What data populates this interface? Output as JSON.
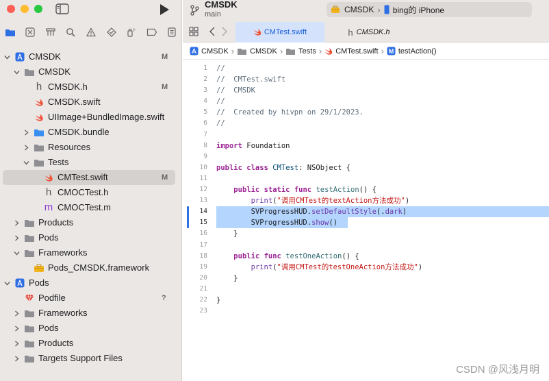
{
  "window": {
    "project_title": "CMSDK",
    "branch": "main",
    "scheme": {
      "target": "CMSDK",
      "device": "bing的 iPhone"
    }
  },
  "tabs": [
    {
      "label": "CMTest.swift",
      "active": true,
      "icon": "swift-file-icon"
    },
    {
      "label": "CMSDK.h",
      "active": false,
      "icon": "header-file-icon"
    }
  ],
  "breadcrumb": [
    "CMSDK",
    "CMSDK",
    "Tests",
    "CMTest.swift",
    "testAction()"
  ],
  "navigator": [
    {
      "label": "CMSDK",
      "level": 0,
      "icon": "app-project-icon",
      "chevron": "down",
      "badge": "M"
    },
    {
      "label": "CMSDK",
      "level": 1,
      "icon": "folder-icon",
      "chevron": "down",
      "badge": ""
    },
    {
      "label": "CMSDK.h",
      "level": 2,
      "icon": "header-file-icon",
      "chevron": "",
      "badge": "M"
    },
    {
      "label": "CMSDK.swift",
      "level": 2,
      "icon": "swift-file-icon",
      "chevron": "",
      "badge": ""
    },
    {
      "label": "UIImage+BundledImage.swift",
      "level": 2,
      "icon": "swift-file-icon",
      "chevron": "",
      "badge": ""
    },
    {
      "label": "CMSDK.bundle",
      "level": 2,
      "icon": "bundle-folder-icon",
      "chevron": "right",
      "badge": ""
    },
    {
      "label": "Resources",
      "level": 2,
      "icon": "folder-icon",
      "chevron": "right",
      "badge": ""
    },
    {
      "label": "Tests",
      "level": 2,
      "icon": "folder-icon",
      "chevron": "down",
      "badge": ""
    },
    {
      "label": "CMTest.swift",
      "level": 3,
      "icon": "swift-file-icon",
      "chevron": "",
      "badge": "M",
      "selected": true
    },
    {
      "label": "CMOCTest.h",
      "level": 3,
      "icon": "header-file-icon",
      "chevron": "",
      "badge": ""
    },
    {
      "label": "CMOCTest.m",
      "level": 3,
      "icon": "objc-file-icon",
      "chevron": "",
      "badge": ""
    },
    {
      "label": "Products",
      "level": 1,
      "icon": "folder-icon",
      "chevron": "right",
      "badge": ""
    },
    {
      "label": "Pods",
      "level": 1,
      "icon": "folder-icon",
      "chevron": "right",
      "badge": ""
    },
    {
      "label": "Frameworks",
      "level": 1,
      "icon": "folder-icon",
      "chevron": "down",
      "badge": ""
    },
    {
      "label": "Pods_CMSDK.framework",
      "level": 2,
      "icon": "framework-icon",
      "chevron": "",
      "badge": ""
    },
    {
      "label": "Pods",
      "level": 0,
      "icon": "app-project-icon",
      "chevron": "down",
      "badge": ""
    },
    {
      "label": "Podfile",
      "level": 1,
      "icon": "ruby-file-icon",
      "chevron": "",
      "badge": "?"
    },
    {
      "label": "Frameworks",
      "level": 1,
      "icon": "folder-icon",
      "chevron": "right",
      "badge": ""
    },
    {
      "label": "Pods",
      "level": 1,
      "icon": "folder-icon",
      "chevron": "right",
      "badge": ""
    },
    {
      "label": "Products",
      "level": 1,
      "icon": "folder-icon",
      "chevron": "right",
      "badge": ""
    },
    {
      "label": "Targets Support Files",
      "level": 1,
      "icon": "folder-icon",
      "chevron": "right",
      "badge": ""
    }
  ],
  "code": [
    {
      "n": "1",
      "hl": false,
      "parts": [
        [
          "cm",
          "//"
        ]
      ]
    },
    {
      "n": "2",
      "hl": false,
      "parts": [
        [
          "cm",
          "//  CMTest.swift"
        ]
      ]
    },
    {
      "n": "3",
      "hl": false,
      "parts": [
        [
          "cm",
          "//  CMSDK"
        ]
      ]
    },
    {
      "n": "4",
      "hl": false,
      "parts": [
        [
          "cm",
          "//"
        ]
      ]
    },
    {
      "n": "5",
      "hl": false,
      "parts": [
        [
          "cm",
          "//  Created by hivpn on 29/1/2023."
        ]
      ]
    },
    {
      "n": "6",
      "hl": false,
      "parts": [
        [
          "cm",
          "//"
        ]
      ]
    },
    {
      "n": "7",
      "hl": false,
      "parts": []
    },
    {
      "n": "8",
      "hl": false,
      "parts": [
        [
          "kw",
          "import"
        ],
        [
          "pl",
          " Foundation"
        ]
      ]
    },
    {
      "n": "9",
      "hl": false,
      "parts": []
    },
    {
      "n": "10",
      "hl": false,
      "parts": [
        [
          "kw",
          "public"
        ],
        [
          "pl",
          " "
        ],
        [
          "kw",
          "class"
        ],
        [
          "pl",
          " "
        ],
        [
          "ty",
          "CMTest"
        ],
        [
          "pl",
          ": NSObject {"
        ]
      ]
    },
    {
      "n": "11",
      "hl": false,
      "parts": []
    },
    {
      "n": "12",
      "hl": false,
      "parts": [
        [
          "pl",
          "    "
        ],
        [
          "kw",
          "public"
        ],
        [
          "pl",
          " "
        ],
        [
          "kw",
          "static"
        ],
        [
          "pl",
          " "
        ],
        [
          "kw",
          "func"
        ],
        [
          "pl",
          " "
        ],
        [
          "fn",
          "testAction"
        ],
        [
          "pl",
          "() {"
        ]
      ]
    },
    {
      "n": "13",
      "hl": false,
      "parts": [
        [
          "pl",
          "        "
        ],
        [
          "ca",
          "print"
        ],
        [
          "pl",
          "("
        ],
        [
          "str",
          "\"调用CMTest的textAction方法成功\""
        ],
        [
          "pl",
          ")"
        ]
      ]
    },
    {
      "n": "14",
      "hl": true,
      "parts": [
        [
          "pl",
          "        SVProgressHUD."
        ],
        [
          "ca",
          "setDefaultStyle"
        ],
        [
          "pl",
          "(."
        ],
        [
          "ca",
          "dark"
        ],
        [
          "pl",
          ")"
        ]
      ]
    },
    {
      "n": "15",
      "hl": true,
      "parts": [
        [
          "pl",
          "        SVProgressHUD."
        ],
        [
          "ca",
          "show"
        ],
        [
          "pl",
          "()"
        ]
      ]
    },
    {
      "n": "16",
      "hl": false,
      "parts": [
        [
          "pl",
          "    }"
        ]
      ]
    },
    {
      "n": "17",
      "hl": false,
      "parts": []
    },
    {
      "n": "18",
      "hl": false,
      "parts": [
        [
          "pl",
          "    "
        ],
        [
          "kw",
          "public"
        ],
        [
          "pl",
          " "
        ],
        [
          "kw",
          "func"
        ],
        [
          "pl",
          " "
        ],
        [
          "fn",
          "testOneAction"
        ],
        [
          "pl",
          "() {"
        ]
      ]
    },
    {
      "n": "19",
      "hl": false,
      "parts": [
        [
          "pl",
          "        "
        ],
        [
          "ca",
          "print"
        ],
        [
          "pl",
          "("
        ],
        [
          "str",
          "\"调用CMTest的testOneAction方法成功\""
        ],
        [
          "pl",
          ")"
        ]
      ]
    },
    {
      "n": "20",
      "hl": false,
      "parts": [
        [
          "pl",
          "    }"
        ]
      ]
    },
    {
      "n": "21",
      "hl": false,
      "parts": []
    },
    {
      "n": "22",
      "hl": false,
      "parts": [
        [
          "pl",
          "}"
        ]
      ]
    },
    {
      "n": "23",
      "hl": false,
      "parts": []
    }
  ],
  "watermark": "CSDN @风浅月明",
  "colors": {
    "accent": "#2f6fe4",
    "selection": "#b3d5fe",
    "sidebar": "#ebe7e5"
  }
}
